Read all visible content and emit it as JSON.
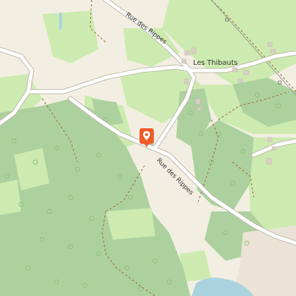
{
  "map": {
    "colors": {
      "meadow": "#f2efe2",
      "grass": "#cdebb0",
      "forest": "#add19e",
      "water": "#aad3df",
      "road": "#ffffff",
      "road_casing": "#b8b4a8",
      "building": "#d9d0c9",
      "marker": "#f05a24"
    },
    "place_labels": {
      "hamlet": "Les Thibauts"
    },
    "road_labels": {
      "north": "Rue des Rippes",
      "south": "Rue des Rippes"
    },
    "marker": {
      "icon": "map-pin-icon"
    }
  }
}
